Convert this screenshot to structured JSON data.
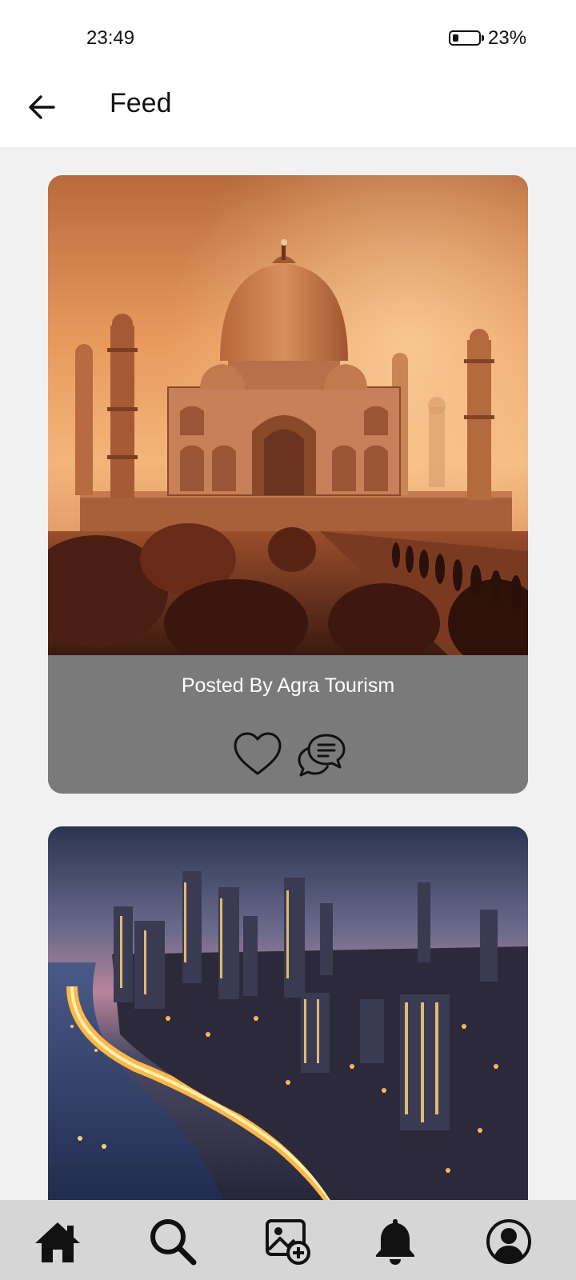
{
  "status": {
    "time": "23:49",
    "battery": "23%"
  },
  "app_bar": {
    "title": "Feed",
    "back_icon": "arrow-left-icon"
  },
  "posts": [
    {
      "caption": "Posted By Agra Tourism",
      "image": "taj-mahal-sunset-photo",
      "actions": [
        "heart-icon",
        "comment-icon"
      ]
    },
    {
      "caption": "",
      "image": "city-skyline-night-photo"
    }
  ],
  "bottom_nav": [
    {
      "name": "home",
      "icon": "home-icon"
    },
    {
      "name": "search",
      "icon": "search-icon"
    },
    {
      "name": "add-post",
      "icon": "add-image-icon"
    },
    {
      "name": "notifications",
      "icon": "bell-icon"
    },
    {
      "name": "profile",
      "icon": "user-circle-icon"
    }
  ],
  "colors": {
    "card_footer": "#7a7a7a",
    "nav_bg": "#d6d6d6",
    "feed_bg": "#f1f1f1"
  }
}
